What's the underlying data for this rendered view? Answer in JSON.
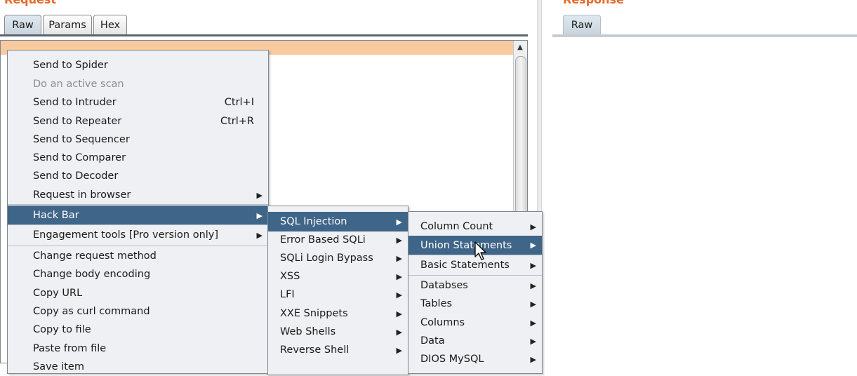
{
  "request_panel": {
    "title": "Request",
    "tabs": [
      "Raw",
      "Params",
      "Hex"
    ]
  },
  "response_panel": {
    "title": "Response",
    "tabs": [
      "Raw"
    ]
  },
  "editor": {
    "scroll_up_glyph": "▲"
  },
  "context_menu": {
    "items": [
      {
        "label": "Send to Spider"
      },
      {
        "label": "Do an active scan",
        "disabled": true
      },
      {
        "label": "Send to Intruder",
        "shortcut": "Ctrl+I"
      },
      {
        "label": "Send to Repeater",
        "shortcut": "Ctrl+R"
      },
      {
        "label": "Send to Sequencer"
      },
      {
        "label": "Send to Comparer"
      },
      {
        "label": "Send to Decoder"
      },
      {
        "label": "Request in browser",
        "submenu": true
      },
      {
        "label": "Hack Bar",
        "submenu": true,
        "selected": true
      },
      {
        "label": "Engagement tools [Pro version only]",
        "submenu": true
      },
      {
        "label": "Change request method"
      },
      {
        "label": "Change body encoding"
      },
      {
        "label": "Copy URL"
      },
      {
        "label": "Copy as curl command"
      },
      {
        "label": "Copy to file"
      },
      {
        "label": "Paste from file"
      },
      {
        "label": "Save item"
      }
    ]
  },
  "hackbar_menu": {
    "items": [
      {
        "label": "SQL Injection",
        "selected": true
      },
      {
        "label": "Error Based SQLi"
      },
      {
        "label": "SQLi Login Bypass"
      },
      {
        "label": "XSS"
      },
      {
        "label": "LFI"
      },
      {
        "label": "XXE Snippets"
      },
      {
        "label": "Web Shells"
      },
      {
        "label": "Reverse Shell"
      }
    ]
  },
  "sqli_menu": {
    "items": [
      {
        "label": "Column Count"
      },
      {
        "label": "Union Statements",
        "selected": true
      },
      {
        "label": "Basic Statements"
      },
      {
        "label": "Databses"
      },
      {
        "label": "Tables"
      },
      {
        "label": "Columns"
      },
      {
        "label": "Data"
      },
      {
        "label": "DIOS MySQL"
      }
    ]
  },
  "submenu_arrow": "▶",
  "colors": {
    "title": "#e8692c",
    "selection": "#3f6588",
    "menu_bg": "#eef0f3",
    "editor_highlight": "#f9c99f"
  }
}
